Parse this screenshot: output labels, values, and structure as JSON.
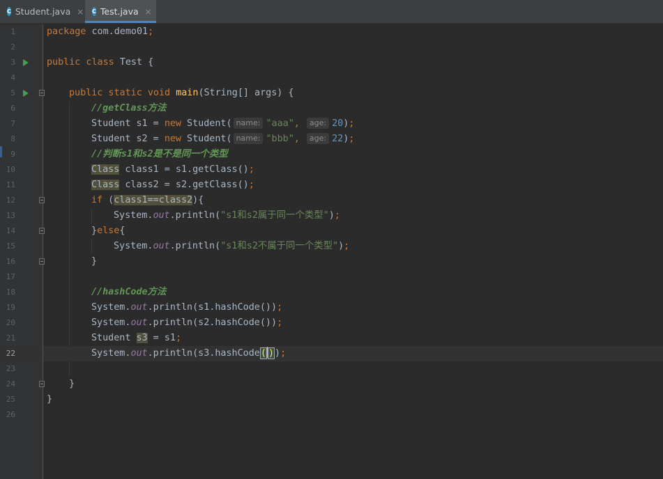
{
  "tabs": [
    {
      "label": "Student.java",
      "icon": "java-class-icon",
      "active": false,
      "close": "×"
    },
    {
      "label": "Test.java",
      "icon": "java-class-icon",
      "active": true,
      "close": "×"
    }
  ],
  "class_icon_letter": "C",
  "gutter": {
    "line_numbers": [
      "1",
      "2",
      "3",
      "4",
      "5",
      "6",
      "7",
      "8",
      "9",
      "10",
      "11",
      "12",
      "13",
      "14",
      "15",
      "16",
      "17",
      "18",
      "19",
      "20",
      "21",
      "22",
      "23",
      "24",
      "25",
      "26"
    ],
    "current_line": "22"
  },
  "code": {
    "l1": {
      "kw": "package",
      "rest": " com.demo01",
      "semi": ";"
    },
    "l3": {
      "kw": "public class",
      "rest": " Test {"
    },
    "l5": {
      "kw": "public static void",
      "sp": " ",
      "fn": "main",
      "rest": "(String[] args) {"
    },
    "l6": {
      "comment": "//getClass方法"
    },
    "l7": {
      "a": "Student s1 = ",
      "kw": "new",
      "b": " Student(",
      "hint1": "name:",
      "str": "\"aaa\"",
      "kw2": ",",
      "hint2": "age:",
      "num": "20",
      "end": ")",
      "semi": ";"
    },
    "l8": {
      "a": "Student s2 = ",
      "kw": "new",
      "b": " Student(",
      "hint1": "name:",
      "str": "\"bbb\"",
      "kw2": ",",
      "hint2": "age:",
      "num": "22",
      "end": ")",
      "semi": ";"
    },
    "l9": {
      "comment": "//判断s1和s2是不是同一个类型"
    },
    "l10": {
      "hl": "Class",
      "rest": " class1 = s1.getClass()",
      "semi": ";"
    },
    "l11": {
      "hl": "Class",
      "rest": " class2 = s2.getClass()",
      "semi": ";"
    },
    "l12": {
      "kw": "if",
      "a": " (",
      "hl": "class1==class2",
      "b": "){"
    },
    "l13": {
      "a": "System.",
      "field": "out",
      "b": ".println(",
      "str": "\"s1和s2属于同一个类型\"",
      "c": ")",
      "semi": ";"
    },
    "l14": {
      "a": "}",
      "kw": "else",
      "b": "{"
    },
    "l15": {
      "a": "System.",
      "field": "out",
      "b": ".println(",
      "str": "\"s1和s2不属于同一个类型\"",
      "c": ")",
      "semi": ";"
    },
    "l16": {
      "a": "}"
    },
    "l18": {
      "comment": "//hashCode方法"
    },
    "l19": {
      "a": "System.",
      "field": "out",
      "b": ".println(s1.hashCode())",
      "semi": ";"
    },
    "l20": {
      "a": "System.",
      "field": "out",
      "b": ".println(s2.hashCode())",
      "semi": ";"
    },
    "l21": {
      "a": "Student ",
      "hl": "s3",
      "b": " = s1",
      "semi": ";"
    },
    "l22": {
      "a": "System.",
      "field": "out",
      "b": ".println(s3.hashCode",
      "open": "(",
      "close": ")",
      "c": ")",
      "semi": ";"
    },
    "l24": {
      "a": "}"
    },
    "l25": {
      "a": "}"
    }
  },
  "colors": {
    "background": "#2b2b2b",
    "keyword": "#cc7832",
    "string": "#6a8759",
    "number": "#6897bb",
    "comment": "#629755",
    "method": "#ffc66d",
    "field": "#9876aa",
    "text": "#a9b7c6",
    "tab_accent": "#4a88c7",
    "run_icon": "#499c54"
  }
}
